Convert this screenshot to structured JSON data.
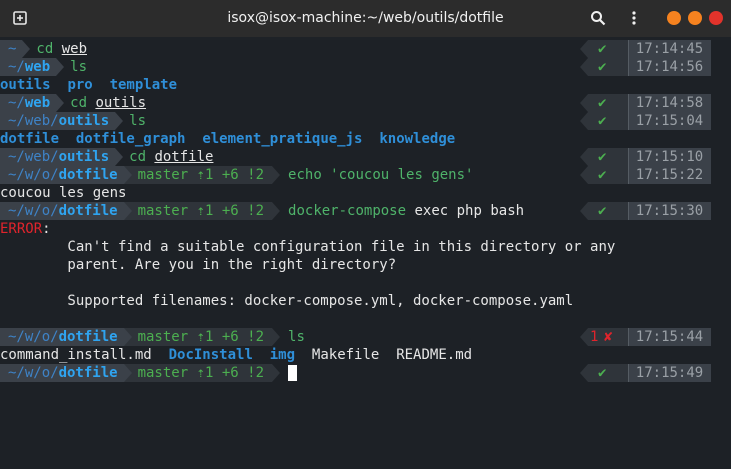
{
  "window": {
    "title": "isox@isox-machine:~/web/outils/dotfile",
    "icon": "terminal-new-tab-icon",
    "search_icon": "search-icon",
    "menu_icon": "menu-icon",
    "controls": {
      "minimize": "#f5821f",
      "maximize": "#f5821f",
      "close": "#e2332b"
    }
  },
  "colors": {
    "dir_fg": "#3f8bd6",
    "dir_bold": "#1e9be6",
    "git_fg": "#4caf50",
    "cmd": "#4fb36a",
    "check": "#4caf50",
    "cross": "#e0242c",
    "error": "#e0242c"
  },
  "lines": [
    {
      "type": "prompt",
      "path": [
        "~"
      ],
      "cmd": "cd ",
      "cmd_arg": "web",
      "time": "17:14:45",
      "status": "ok"
    },
    {
      "type": "prompt",
      "path": [
        "~/",
        "web"
      ],
      "cmd": "ls",
      "time": "17:14:56",
      "status": "ok"
    },
    {
      "type": "ls",
      "items": [
        "outils",
        "pro",
        "template"
      ]
    },
    {
      "type": "prompt",
      "path": [
        "~/",
        "web"
      ],
      "cmd": "cd ",
      "cmd_arg": "outils",
      "time": "17:14:58",
      "status": "ok"
    },
    {
      "type": "prompt",
      "path": [
        "~/web/",
        "outils"
      ],
      "cmd": "ls",
      "time": "17:15:04",
      "status": "ok"
    },
    {
      "type": "ls",
      "items": [
        "dotfile",
        "dotfile_graph",
        "element_pratique_js",
        "knowledge"
      ]
    },
    {
      "type": "prompt",
      "path": [
        "~/web/",
        "outils"
      ],
      "cmd": "cd ",
      "cmd_arg": "dotfile",
      "time": "17:15:10",
      "status": "ok"
    },
    {
      "type": "gitprompt",
      "path": [
        "~/w/o/",
        "dotfile"
      ],
      "git": "master ⇡1 +6 !2",
      "cmd": "echo 'coucou les gens'",
      "time": "17:15:22",
      "status": "ok"
    },
    {
      "type": "out",
      "text": "coucou les gens"
    },
    {
      "type": "gitprompt",
      "path": [
        "~/w/o/",
        "dotfile"
      ],
      "git": "master ⇡1 +6 !2",
      "cmd": "docker-compose",
      "cmd_rest": " exec php bash",
      "time": "17:15:30",
      "status": "ok"
    },
    {
      "type": "error",
      "label": "ERROR",
      "text": ":"
    },
    {
      "type": "out",
      "text": "        Can't find a suitable configuration file in this directory or any"
    },
    {
      "type": "out",
      "text": "        parent. Are you in the right directory?"
    },
    {
      "type": "out",
      "text": ""
    },
    {
      "type": "out",
      "text": "        Supported filenames: docker-compose.yml, docker-compose.yaml"
    },
    {
      "type": "out",
      "text": ""
    },
    {
      "type": "gitprompt",
      "path": [
        "~/w/o/",
        "dotfile"
      ],
      "git": "master ⇡1 +6 !2",
      "cmd": "ls",
      "time": "17:15:44",
      "status": "err",
      "err_code": "1"
    },
    {
      "type": "ls2",
      "items": [
        {
          "t": "command_install.md",
          "c": "plain"
        },
        {
          "t": "DocInstall",
          "c": "dir"
        },
        {
          "t": "img",
          "c": "dir"
        },
        {
          "t": "Makefile",
          "c": "plain"
        },
        {
          "t": "README.md",
          "c": "plain"
        }
      ]
    },
    {
      "type": "gitprompt",
      "path": [
        "~/w/o/",
        "dotfile"
      ],
      "git": "master ⇡1 +6 !2",
      "cmd": "",
      "time": "17:15:49",
      "status": "ok",
      "cursor": true
    }
  ]
}
